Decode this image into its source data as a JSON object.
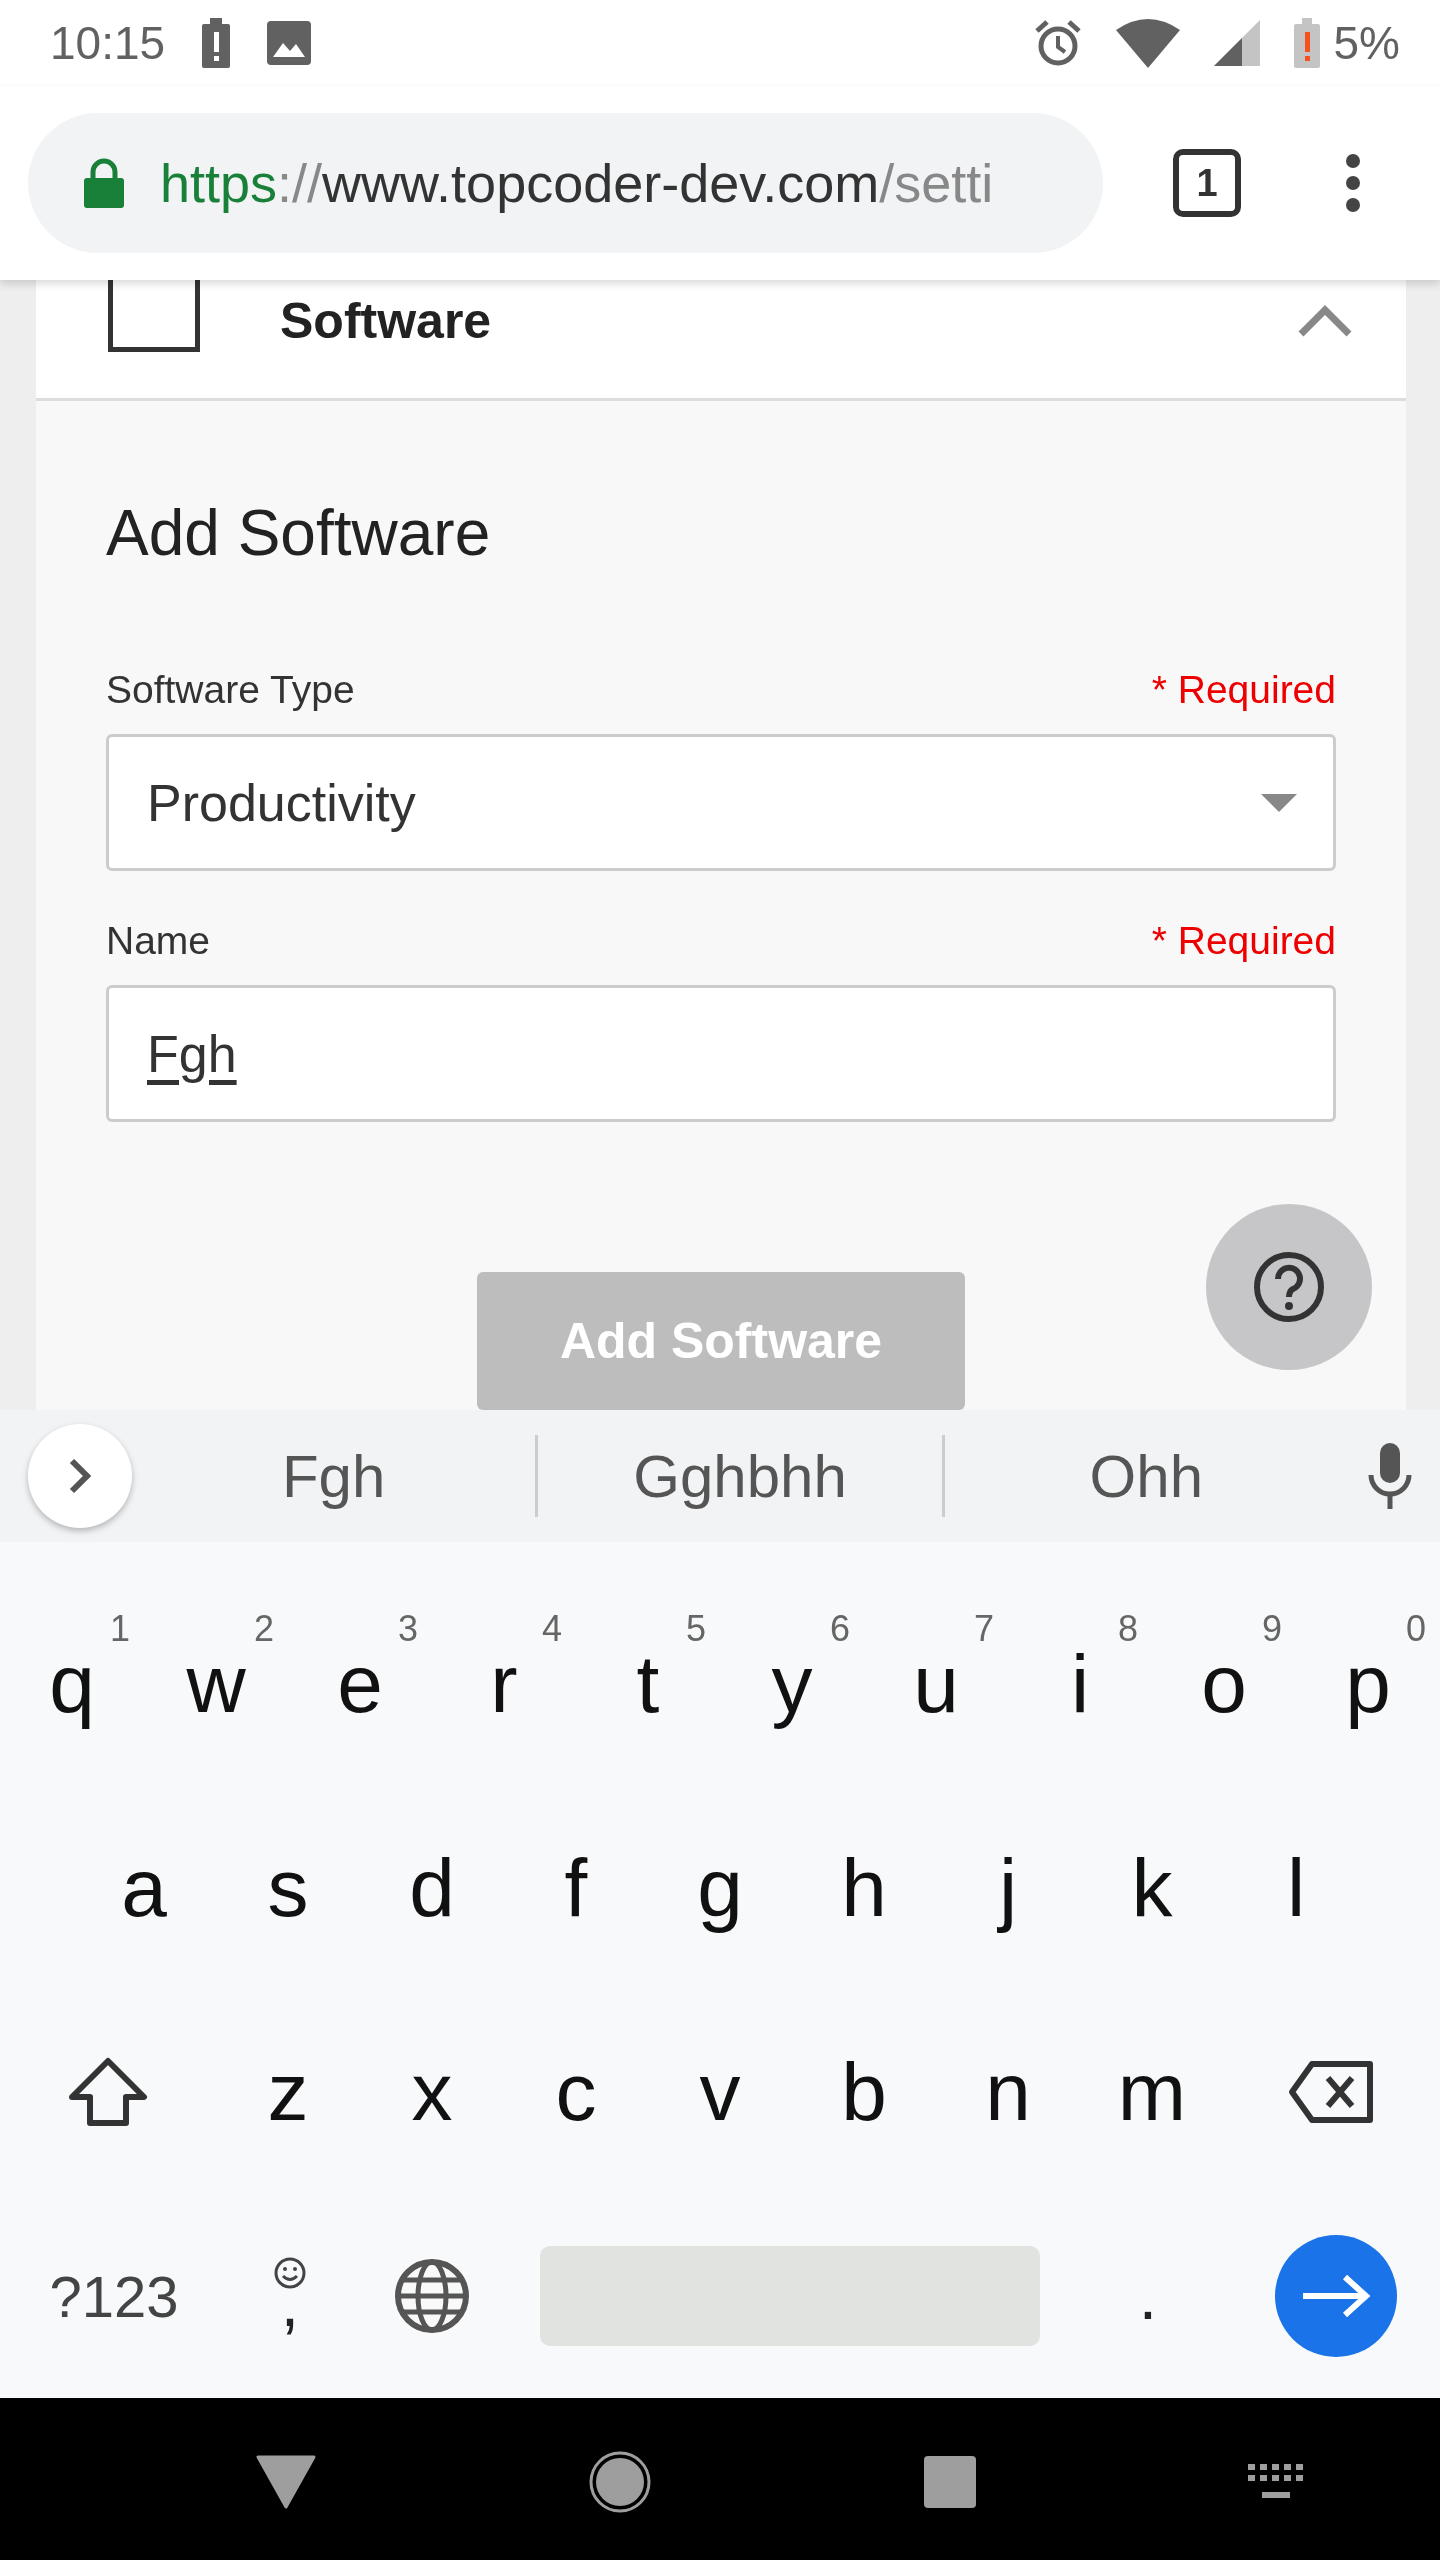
{
  "status_bar": {
    "time": "10:15",
    "battery": "5%"
  },
  "browser": {
    "url_scheme": "https",
    "url_separator": "://",
    "url_host": "www.topcoder-dev.com",
    "url_path": "/setti",
    "tab_count": "1"
  },
  "section": {
    "title": "Software",
    "expanded": true
  },
  "form": {
    "heading": "Add Software",
    "fields": [
      {
        "kind": "select",
        "label": "Software Type",
        "required_text": "* Required",
        "value": "Productivity",
        "composing": false
      },
      {
        "kind": "text",
        "label": "Name",
        "required_text": "* Required",
        "value": "Fgh",
        "composing": true
      }
    ],
    "submit": {
      "label": "Add Software",
      "disabled": true
    }
  },
  "keyboard": {
    "suggestions": [
      "Fgh",
      "Gghbhh",
      "Ohh"
    ],
    "rows": [
      [
        {
          "key": "q",
          "hint": "1"
        },
        {
          "key": "w",
          "hint": "2"
        },
        {
          "key": "e",
          "hint": "3"
        },
        {
          "key": "r",
          "hint": "4"
        },
        {
          "key": "t",
          "hint": "5"
        },
        {
          "key": "y",
          "hint": "6"
        },
        {
          "key": "u",
          "hint": "7"
        },
        {
          "key": "i",
          "hint": "8"
        },
        {
          "key": "o",
          "hint": "9"
        },
        {
          "key": "p",
          "hint": "0"
        }
      ],
      [
        {
          "key": "a"
        },
        {
          "key": "s"
        },
        {
          "key": "d"
        },
        {
          "key": "f"
        },
        {
          "key": "g"
        },
        {
          "key": "h"
        },
        {
          "key": "j"
        },
        {
          "key": "k"
        },
        {
          "key": "l"
        }
      ],
      [
        {
          "key": "z"
        },
        {
          "key": "x"
        },
        {
          "key": "c"
        },
        {
          "key": "v"
        },
        {
          "key": "b"
        },
        {
          "key": "n"
        },
        {
          "key": "m"
        }
      ]
    ],
    "symbols_key": "?123",
    "comma_key": ",",
    "period_key": "."
  }
}
